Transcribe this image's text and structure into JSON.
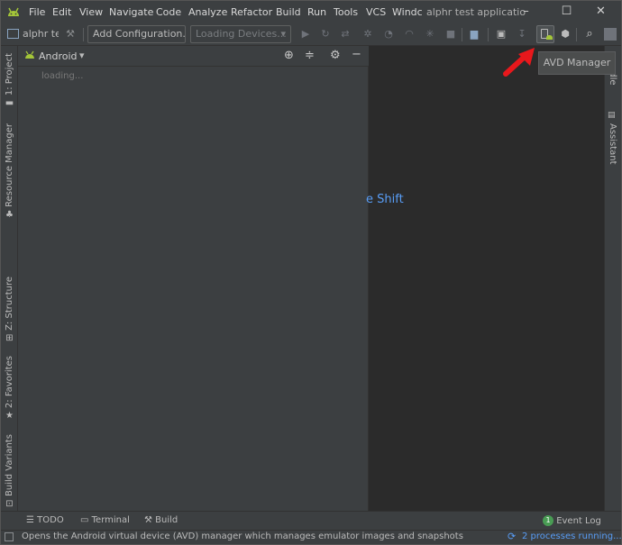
{
  "menu": {
    "items": [
      "File",
      "Edit",
      "View",
      "Navigate",
      "Code",
      "Analyze",
      "Refactor",
      "Build",
      "Run",
      "Tools",
      "VCS",
      "Windc"
    ],
    "window_title": "alphr test applicatio"
  },
  "toolbar": {
    "project_name": "alphr te:",
    "add_config": "Add Configuration...",
    "devices": "Loading Devices..."
  },
  "tooltip": {
    "text": "AVD Manager"
  },
  "left_stripe": {
    "project": "1: Project",
    "resource_manager": "Resource Manager",
    "structure": "Z: Structure",
    "favorites": "2: Favorites",
    "build_variants": "Build Variants"
  },
  "right_stripe": {
    "gradle": "radle",
    "assistant": "Assistant"
  },
  "project_panel": {
    "view_name": "Android",
    "loading": "loading..."
  },
  "editor": {
    "hint": "e Shift"
  },
  "bottom_tabs": {
    "todo": "TODO",
    "terminal": "Terminal",
    "build": "Build",
    "event_log": "Event Log",
    "event_count": "1"
  },
  "status": {
    "message": "Opens the Android virtual device (AVD) manager which manages emulator images and snapshots",
    "processes": "2 processes running..."
  },
  "colors": {
    "android_green": "#a4c639",
    "accent_blue": "#589df6",
    "arrow_red": "#e8181c"
  }
}
